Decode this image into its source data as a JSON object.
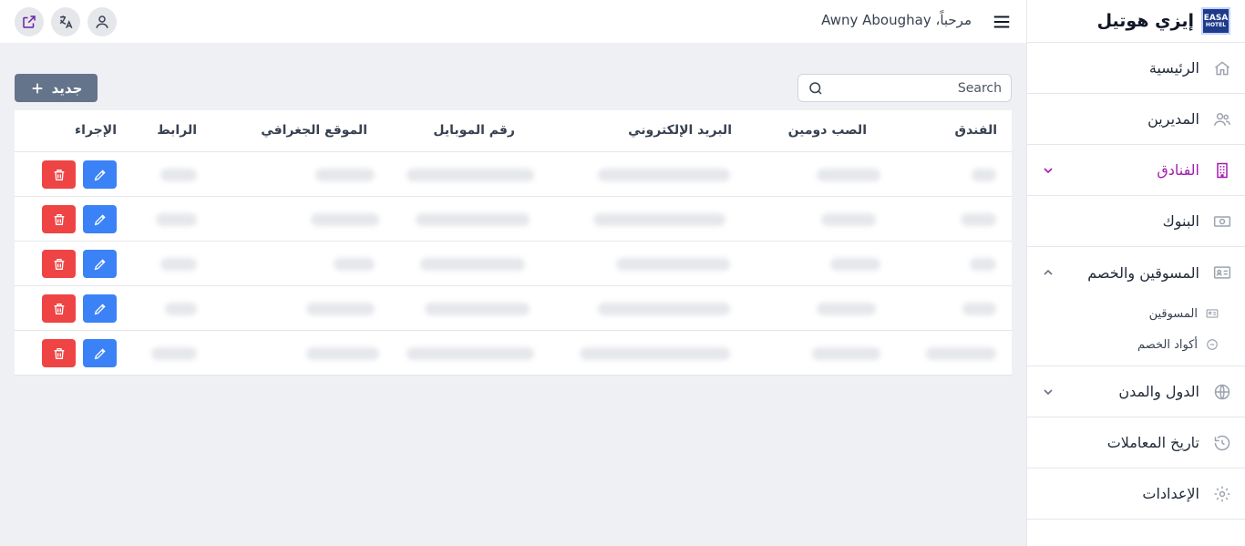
{
  "brand": {
    "name": "إيزي هوتيل",
    "logo_top": "EASA",
    "logo_bottom": "HOTEL"
  },
  "header": {
    "welcome": "مرحباً، Awny Aboughay"
  },
  "sidebar": {
    "items": [
      {
        "label": "الرئيسية",
        "icon": "home-icon"
      },
      {
        "label": "المديرين",
        "icon": "users-icon"
      },
      {
        "label": "الفنادق",
        "icon": "building-icon",
        "active": true
      },
      {
        "label": "البنوك",
        "icon": "banknote-icon"
      },
      {
        "label": "المسوقين والخصم",
        "icon": "id-card-icon",
        "expanded": true,
        "children": [
          {
            "label": "المسوقين"
          },
          {
            "label": "أكواد الخصم"
          }
        ]
      },
      {
        "label": "الدول والمدن",
        "icon": "globe-icon"
      },
      {
        "label": "تاريخ المعاملات",
        "icon": "history-icon"
      },
      {
        "label": "الإعدادات",
        "icon": "gear-icon"
      }
    ]
  },
  "toolbar": {
    "new_label": "جديد",
    "search_placeholder": "Search"
  },
  "table": {
    "columns": [
      "الفندق",
      "الصب دومين",
      "البريد الإلكتروني",
      "رقم الموبايل",
      "الموقع الجغرافي",
      "الرابط",
      "الإجراء"
    ],
    "row_count": 5
  },
  "colors": {
    "accent": "#a21caf",
    "edit": "#3b82f6",
    "delete": "#ef4444",
    "new_button": "#64748b"
  }
}
